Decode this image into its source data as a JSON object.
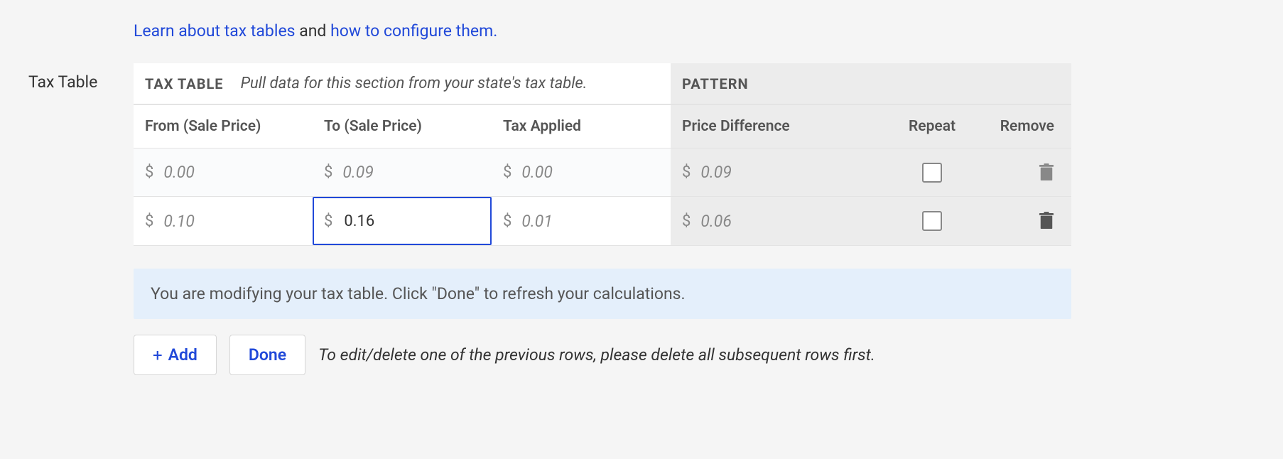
{
  "intro": {
    "link1": "Learn about tax tables",
    "middle": " and ",
    "link2": "how to configure them.",
    "after": ""
  },
  "leftLabel": "Tax Table",
  "sectionHeader": {
    "leftTitle": "TAX TABLE",
    "leftHint": "Pull data for this section from your state's tax table.",
    "rightTitle": "PATTERN"
  },
  "columns": {
    "from": "From (Sale Price)",
    "to": "To (Sale Price)",
    "tax": "Tax Applied",
    "diff": "Price Difference",
    "repeat": "Repeat",
    "remove": "Remove"
  },
  "currencySymbol": "$",
  "rows": [
    {
      "from": "0.00",
      "to": "0.09",
      "tax": "0.00",
      "diff": "0.09",
      "editingTo": false
    },
    {
      "from": "0.10",
      "to": "0.16",
      "tax": "0.01",
      "diff": "0.06",
      "editingTo": true
    }
  ],
  "banner": "You are modifying your tax table. Click \"Done\" to refresh your calculations.",
  "buttons": {
    "add": "Add",
    "done": "Done"
  },
  "actionsHint": "To edit/delete one of the previous rows, please delete all subsequent rows first."
}
